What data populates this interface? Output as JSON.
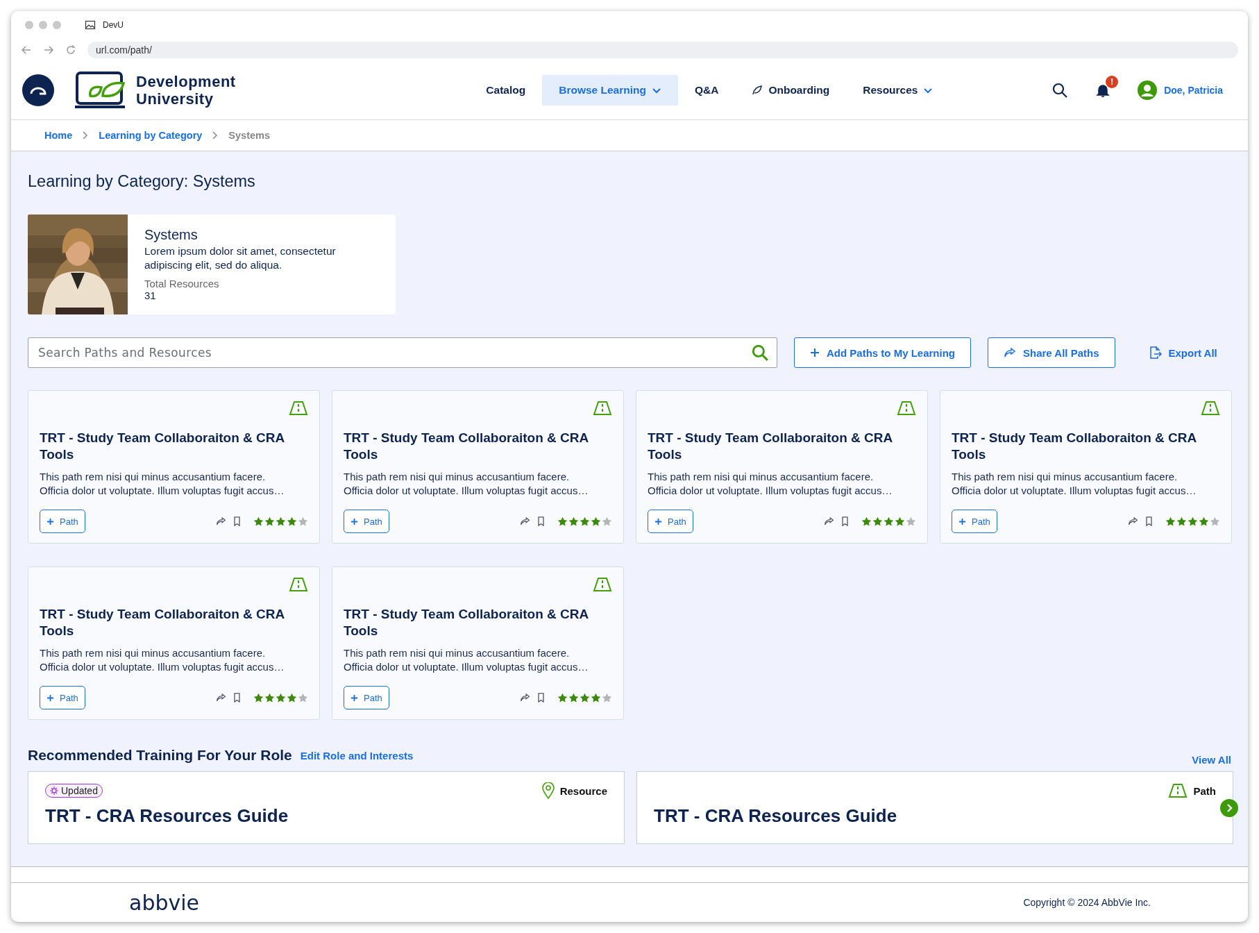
{
  "browser": {
    "tab_title": "DevU",
    "url": "url.com/path/"
  },
  "header": {
    "logo_text": [
      "Development",
      "University"
    ],
    "nav": [
      {
        "label": "Catalog",
        "kind": "plain",
        "selected": false
      },
      {
        "label": "Browse Learning",
        "kind": "dropdown",
        "selected": true
      },
      {
        "label": "Q&A",
        "kind": "plain",
        "selected": false
      },
      {
        "label": "Onboarding",
        "kind": "icon",
        "selected": false
      },
      {
        "label": "Resources",
        "kind": "dropdown",
        "selected": false
      }
    ],
    "notification_badge": "!",
    "user": "Doe, Patricia"
  },
  "breadcrumb": [
    {
      "label": "Home",
      "link": true
    },
    {
      "label": "Learning by Category",
      "link": true
    },
    {
      "label": "Systems",
      "link": false
    }
  ],
  "page_title": "Learning by Category: Systems",
  "category": {
    "name": "Systems",
    "description": "Lorem ipsum dolor sit amet, consectetur adipiscing elit, sed do  aliqua.",
    "stat_label": "Total Resources",
    "stat_value": "31"
  },
  "search": {
    "placeholder": "Search Paths and Resources"
  },
  "actions": [
    {
      "label": "Add Paths to My Learning",
      "kind": "add",
      "outlined": true
    },
    {
      "label": "Share All Paths",
      "kind": "share",
      "outlined": true
    },
    {
      "label": "Export All",
      "kind": "export",
      "outlined": false
    }
  ],
  "cards": [
    {
      "title": "TRT - Study Team Collaboraiton & CRA Tools",
      "description": [
        "This path rem nisi qui minus accusantium facere.",
        "Officia dolor ut voluptate. Illum voluptas fugit accus…"
      ],
      "button": "Path",
      "stars": 4
    },
    {
      "title": "TRT - Study Team Collaboraiton & CRA Tools",
      "description": [
        "This path rem nisi qui minus accusantium facere.",
        "Officia dolor ut voluptate. Illum voluptas fugit accus…"
      ],
      "button": "Path",
      "stars": 4
    },
    {
      "title": "TRT - Study Team Collaboraiton & CRA Tools",
      "description": [
        "This path rem nisi qui minus accusantium facere.",
        "Officia dolor ut voluptate. Illum voluptas fugit accus…"
      ],
      "button": "Path",
      "stars": 4
    },
    {
      "title": "TRT - Study Team Collaboraiton & CRA Tools",
      "description": [
        "This path rem nisi qui minus accusantium facere.",
        "Officia dolor ut voluptate. Illum voluptas fugit accus…"
      ],
      "button": "Path",
      "stars": 4
    },
    {
      "title": "TRT - Study Team Collaboraiton & CRA Tools",
      "description": [
        "This path rem nisi qui minus accusantium facere.",
        "Officia dolor ut voluptate. Illum voluptas fugit accus…"
      ],
      "button": "Path",
      "stars": 4
    },
    {
      "title": "TRT - Study Team Collaboraiton & CRA Tools",
      "description": [
        "This path rem nisi qui minus accusantium facere.",
        "Officia dolor ut voluptate. Illum voluptas fugit accus…"
      ],
      "button": "Path",
      "stars": 4
    }
  ],
  "recommended": {
    "title": "Recommended Training For Your Role",
    "edit_link": "Edit Role and Interests",
    "view_all": "View All",
    "items": [
      {
        "badge": "Updated",
        "type": "Resource",
        "kind": "resource",
        "title": "TRT - CRA Resources Guide"
      },
      {
        "type": "Path",
        "kind": "path",
        "title": "TRT - CRA Resources Guide"
      }
    ]
  },
  "footer": {
    "logo": "abbvie",
    "copyright": "Copyright © 2024 AbbVie Inc."
  }
}
